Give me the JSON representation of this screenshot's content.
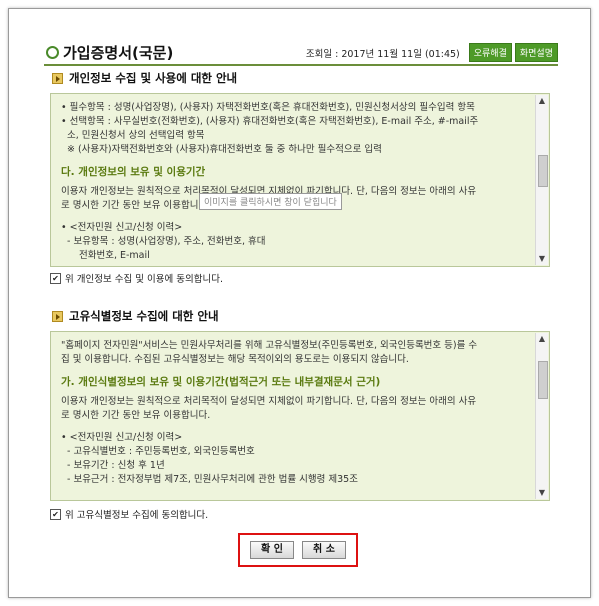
{
  "page": {
    "title": "가입증명서(국문)",
    "date_label": "조회일 : 2017년 11월 11일 (01:45)",
    "btn_error": "오류해결",
    "btn_guide": "화면설명"
  },
  "section1": {
    "heading": "개인정보 수집 및 사용에 대한 안내",
    "lines": [
      "• 필수항목 : 성명(사업장명), (사용자) 자택전화번호(혹은 휴대전화번호), 민원신청서상의 필수입력 항목",
      "• 선택항목 : 사무실번호(전화번호), (사용자) 휴대전화번호(혹은 자택전화번호), E-mail 주소, #-mail주",
      "소, 민원신청서 상의 선택입력 항목",
      "※ (사용자)자택전화번호와 (사용자)휴대전화번호 둘 중 하나만 필수적으로 입력"
    ],
    "sub_title": "다. 개인정보의 보유 및 이용기간",
    "para1": "이용자 개인정보는 원칙적으로 처리목적이 달성되면 지체없이 파기합니다. 단, 다음의 정보는 아래의 사유",
    "para2": "로 명시한 기간 동안 보유 이용합니다.",
    "list": [
      "• <전자민원 신고/신청 이력>",
      "- 보유항목 : 성명(사업장명), 주소, 전화번호, 휴대",
      "전화번호, E-mail"
    ],
    "tooltip": "이미지를 클릭하시면 창이 닫힙니다",
    "agree": "위 개인정보 수집 및 이용에 동의합니다."
  },
  "section2": {
    "heading": "고유식별정보 수집에 대한 안내",
    "intro1": "\"홈페이지 전자민원\"서비스는 민원사무처리를 위해 고유식별정보(주민등록번호, 외국인등록번호 등)를 수",
    "intro2": "집 및 이용합니다. 수집된 고유식별정보는 해당 목적이외의 용도로는 이용되지 않습니다.",
    "sub_title": "가. 개인식별정보의 보유 및 이용기간(법적근거 또는 내부결재문서 근거)",
    "para1": "이용자 개인정보는 원칙적으로 처리목적이 달성되면 지체없이 파기합니다. 단, 다음의 정보는 아래의 사유",
    "para2": "로 명시한 기간 동안 보유 이용합니다.",
    "list": [
      "• <전자민원 신고/신청 이력>",
      "- 고유식별번호 : 주민등록번호, 외국인등록번호",
      "- 보유기간 : 신청 후 1년",
      "- 보유근거 : 전자정부법 제7조, 민원사무처리에 관한 법률 시행령 제35조"
    ],
    "agree": "위 고유식별정보 수집에 동의합니다."
  },
  "buttons": {
    "confirm": "확 인",
    "cancel": "취 소"
  }
}
